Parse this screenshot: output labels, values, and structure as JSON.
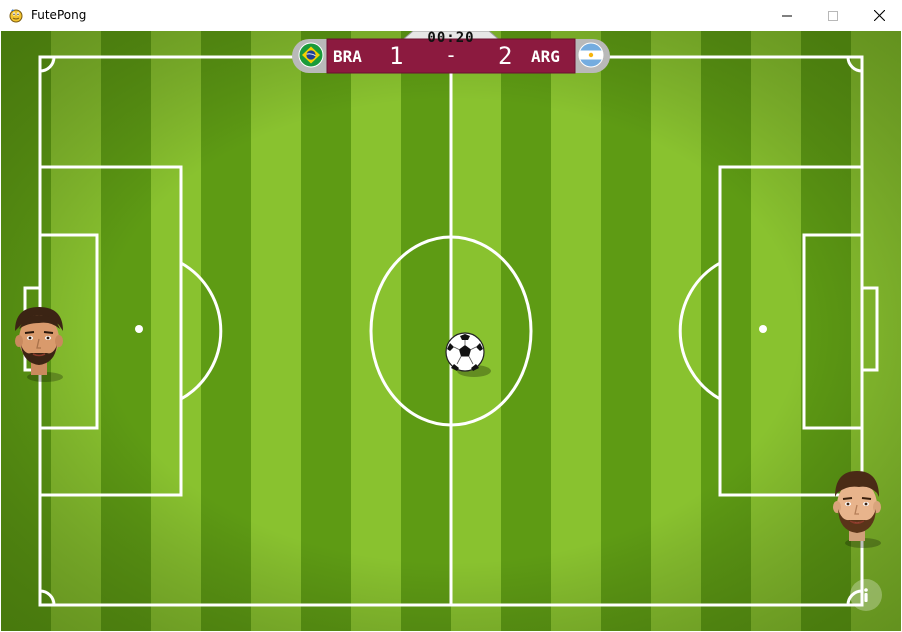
{
  "window": {
    "title": "FutePong"
  },
  "scoreboard": {
    "timer": "00:20",
    "home_team": "BRA",
    "home_score": "1",
    "separator": "-",
    "away_score": "2",
    "away_team": "ARG",
    "home_flag_icon": "brazil-flag-icon",
    "away_flag_icon": "argentina-flag-icon",
    "panel_color": "#8c1a3f",
    "timer_bg_color": "#e6e6e6"
  },
  "field": {
    "grass_dark": "#5e9b14",
    "grass_light": "#89c22f",
    "line_color": "#ffffff"
  },
  "players": {
    "left": {
      "icon": "neymar-face-icon"
    },
    "right": {
      "icon": "messi-face-icon"
    }
  },
  "ball": {
    "icon": "soccer-ball-icon"
  },
  "info_button": {
    "icon": "info-icon"
  }
}
